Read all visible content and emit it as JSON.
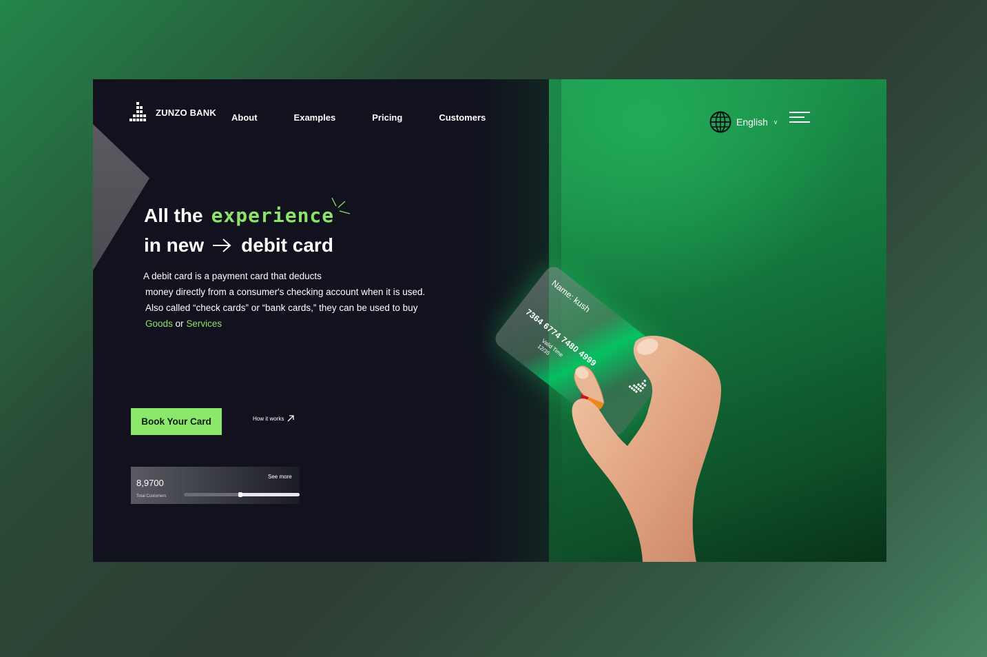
{
  "brand": {
    "name": "ZUNZO BANK"
  },
  "nav": {
    "items": [
      "About",
      "Examples",
      "Pricing",
      "Customers"
    ]
  },
  "language": {
    "selected": "English"
  },
  "hero": {
    "line1_start": "All the",
    "line1_accent": "experience",
    "line2_start": "in new",
    "line2_end": "debit card",
    "desc": {
      "line1": "A debit card is a payment card that deducts",
      "line2": "money directly from a consumer's checking account when it is used.",
      "line3": "Also called “check cards” or “bank cards,” they can be used to buy",
      "goods": "Goods",
      "or": "or",
      "services": "Services"
    }
  },
  "cta": {
    "label": "Book Your Card",
    "secondary": "How it works"
  },
  "stats": {
    "value": "8,9700",
    "label": "Total Customers",
    "see_more": "See more",
    "progress": 0.48
  },
  "card": {
    "name": "Name: kush",
    "number": "7364 6774 7480 4999",
    "valid_label": "Valid Time",
    "valid_value": "12/35"
  },
  "colors": {
    "accent": "#8de26a",
    "cta": "#8be86a",
    "dark": "#11121d",
    "green": "#1e9a50"
  },
  "icons": [
    "logo-icon",
    "globe-icon",
    "chevron-down-icon",
    "menu-icon",
    "arrow-right-icon",
    "arrow-up-right-icon",
    "sparkle-icon",
    "mastercard-icon"
  ]
}
